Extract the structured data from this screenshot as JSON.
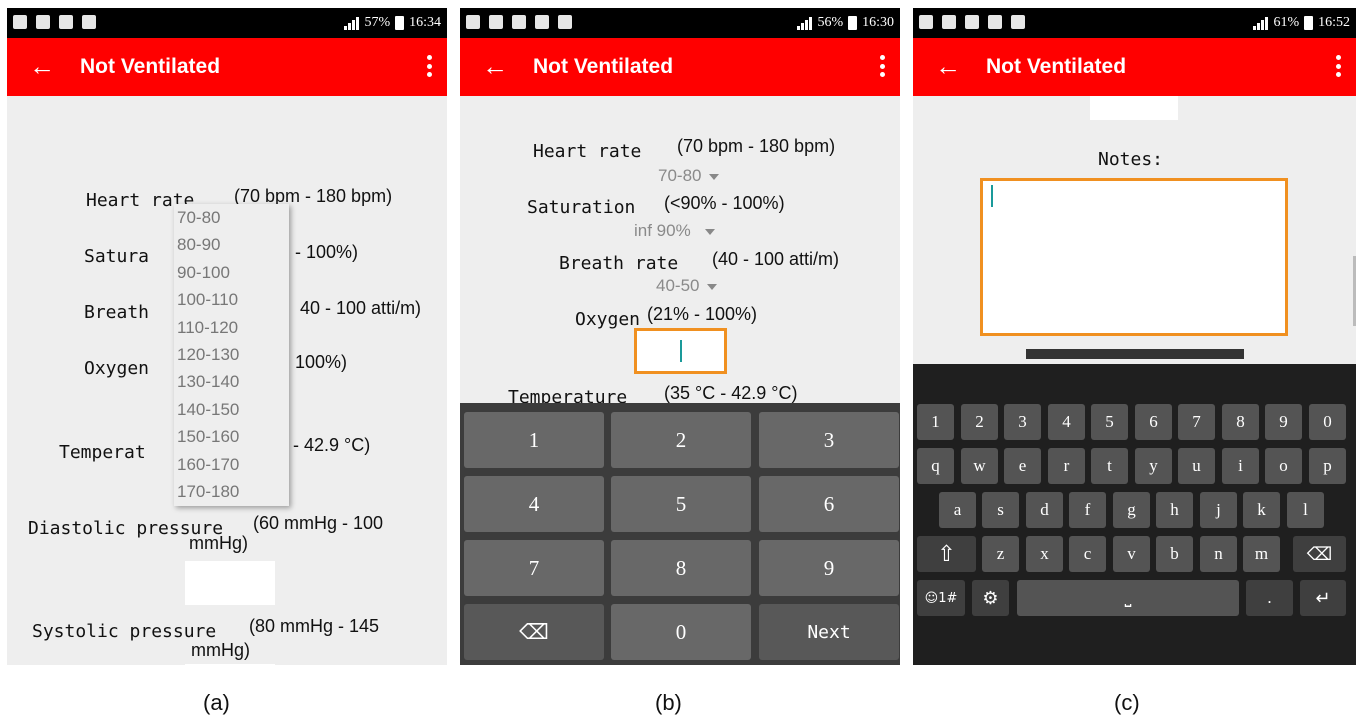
{
  "status": {
    "a": {
      "battery": "57%",
      "time": "16:34"
    },
    "b": {
      "battery": "56%",
      "time": "16:30"
    },
    "c": {
      "battery": "61%",
      "time": "16:52"
    }
  },
  "appbar": {
    "title": "Not Ventilated"
  },
  "panel_a": {
    "heart_rate_label": "Heart rate",
    "heart_rate_range": "(70 bpm - 180 bpm)",
    "saturation_label": "Satura",
    "saturation_range": "- 100%)",
    "breath_label": "Breath",
    "breath_range": "40 - 100 atti/m)",
    "oxygen_label": "Oxygen",
    "oxygen_range": "100%)",
    "temperature_label": "Temperat",
    "temperature_range": "- 42.9 °C)",
    "diastolic_label": "Diastolic pressure",
    "diastolic_range": "(60 mmHg - 100",
    "diastolic_range_2": "mmHg)",
    "systolic_label": "Systolic pressure",
    "systolic_range": "(80 mmHg - 145",
    "systolic_range_2": "mmHg)",
    "dropdown_options": [
      "70-80",
      "80-90",
      "90-100",
      "100-110",
      "110-120",
      "120-130",
      "130-140",
      "140-150",
      "150-160",
      "160-170",
      "170-180"
    ]
  },
  "panel_b": {
    "heart_rate_label": "Heart rate",
    "heart_rate_range": "(70 bpm - 180 bpm)",
    "heart_rate_value": "70-80",
    "saturation_label": "Saturation",
    "saturation_range": "(<90% - 100%)",
    "saturation_value": "inf 90%",
    "breath_label": "Breath rate",
    "breath_range": "(40 - 100 atti/m)",
    "breath_value": "40-50",
    "oxygen_label": "Oxygen",
    "oxygen_range": "(21% - 100%)",
    "temperature_label": "Temperature",
    "temperature_range": "(35 °C - 42.9 °C)",
    "keys": [
      "1",
      "2",
      "3",
      "4",
      "5",
      "6",
      "7",
      "8",
      "9",
      "⌫",
      "0",
      "Next"
    ]
  },
  "panel_c": {
    "notes_label": "Notes:",
    "row_numbers": [
      "1",
      "2",
      "3",
      "4",
      "5",
      "6",
      "7",
      "8",
      "9",
      "0"
    ],
    "row_top": [
      "q",
      "w",
      "e",
      "r",
      "t",
      "y",
      "u",
      "i",
      "o",
      "p"
    ],
    "row_middle": [
      "a",
      "s",
      "d",
      "f",
      "g",
      "h",
      "j",
      "k",
      "l"
    ],
    "row_bottom": [
      "z",
      "x",
      "c",
      "v",
      "b",
      "n",
      "m"
    ],
    "shift_key": "⇧",
    "backspace_key": "⌫",
    "symbols_key": "☺1#",
    "settings_key": "⚙",
    "space_key": "⎵",
    "period_key": ".",
    "enter_key": "↵"
  },
  "captions": [
    "(a)",
    "(b)",
    "(c)"
  ]
}
